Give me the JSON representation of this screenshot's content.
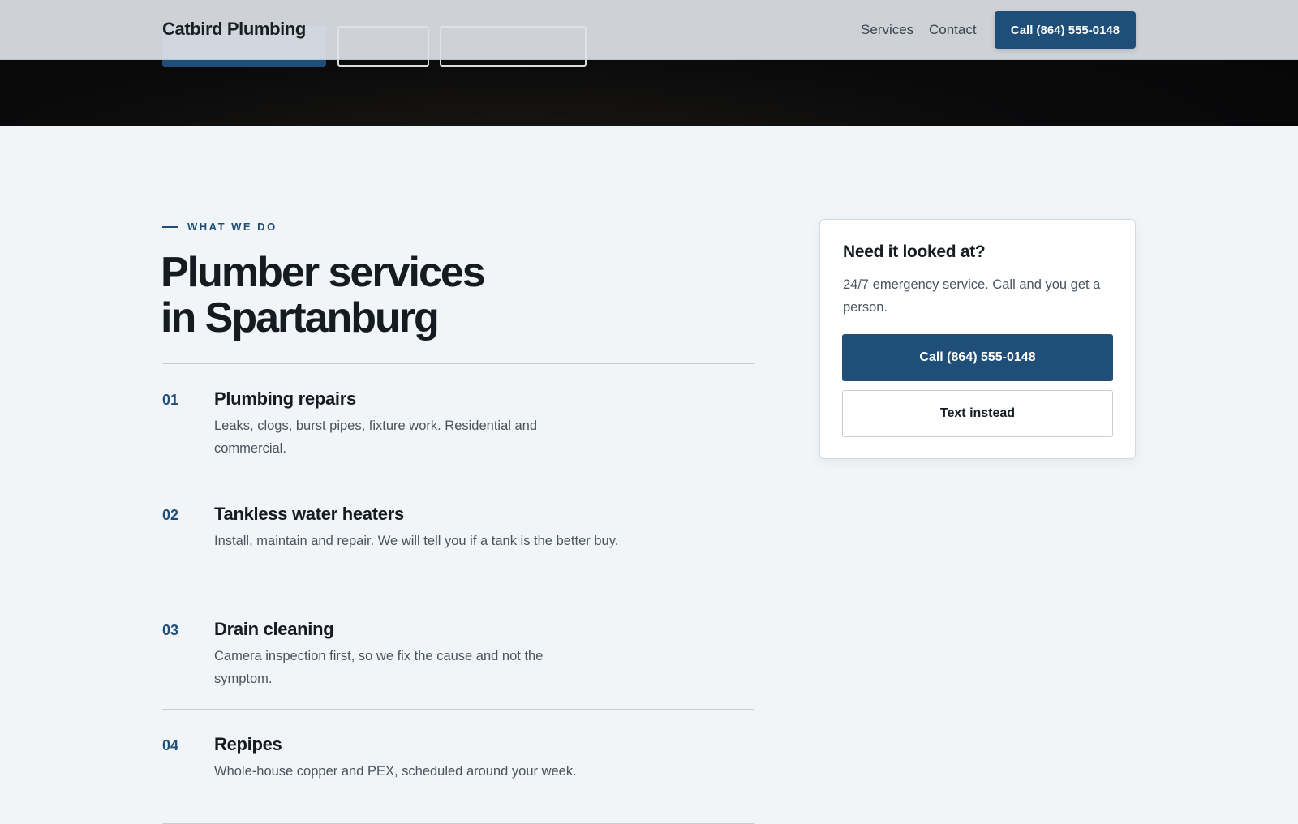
{
  "header": {
    "brand": "Catbird Plumbing",
    "nav": [
      {
        "label": "Services"
      },
      {
        "label": "Contact"
      }
    ],
    "cta_label": "Call (864) 555-0148"
  },
  "services_section": {
    "eyebrow": "WHAT WE DO",
    "title_line1": "Plumber services",
    "title_line2": "in Spartanburg",
    "items": [
      {
        "number": "01",
        "title": "Plumbing repairs",
        "description": "Leaks, clogs, burst pipes, fixture work. Residential and commercial."
      },
      {
        "number": "02",
        "title": "Tankless water heaters",
        "description": "Install, maintain and repair. We will tell you if a tank is the better buy."
      },
      {
        "number": "03",
        "title": "Drain cleaning",
        "description": "Camera inspection first, so we fix the cause and not the symptom."
      },
      {
        "number": "04",
        "title": "Repipes",
        "description": "Whole-house copper and PEX, scheduled around your week."
      }
    ]
  },
  "contact_card": {
    "title": "Need it looked at?",
    "description": "24/7 emergency service. Call and you get a person.",
    "call_label": "Call (864) 555-0148",
    "text_label": "Text instead"
  },
  "colors": {
    "brand_blue": "#1f4e79",
    "page_background": "#f2f5f7",
    "heading_text": "#161b22"
  }
}
